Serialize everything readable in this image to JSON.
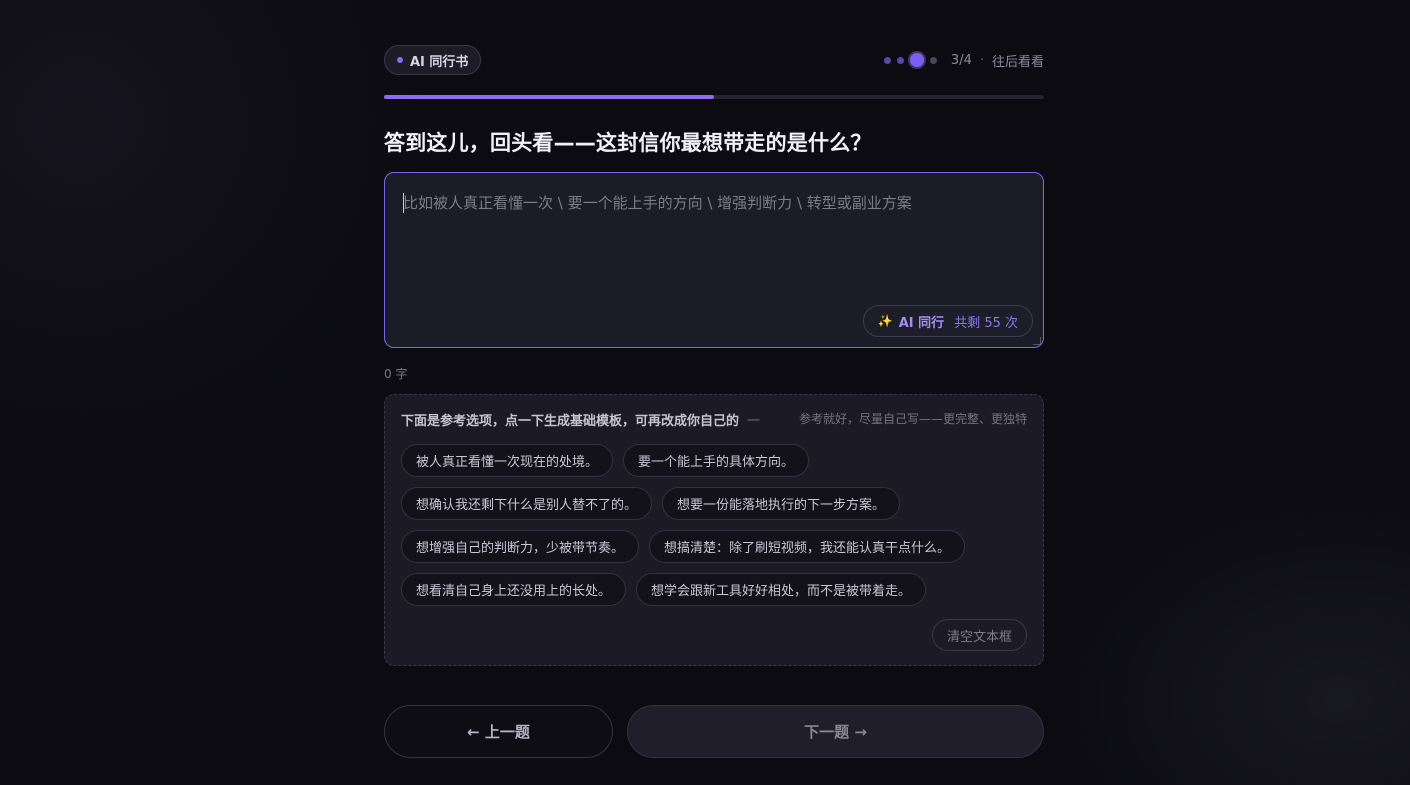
{
  "header": {
    "brand_label": "AI 同行书",
    "step_text": "3/4",
    "separator": "·",
    "skip_label": "往后看看",
    "steps_total": 4,
    "current_step": 3
  },
  "progress": {
    "fraction": 0.5
  },
  "question": {
    "title": "答到这儿，回头看——这封信你最想带走的是什么？"
  },
  "editor": {
    "value": "",
    "placeholder": "比如被人真正看懂一次 \\ 要一个能上手的方向 \\ 增强判断力 \\ 转型或副业方案",
    "ai_button": {
      "icon": "sparkles-icon",
      "label": "AI 同行",
      "remaining": "共剩 55 次"
    },
    "char_count": "0 字"
  },
  "options": {
    "heading": "下面是参考选项，点一下生成基础模板，可再改成你自己的",
    "heading_dash": "一",
    "tip": "参考就好，尽量自己写——更完整、更独特",
    "chips": [
      [
        "被人真正看懂一次现在的处境。",
        "要一个能上手的具体方向。"
      ],
      [
        "想确认我还剩下什么是别人替不了的。",
        "想要一份能落地执行的下一步方案。"
      ],
      [
        "想增强自己的判断力，少被带节奏。",
        "想搞清楚：除了刷短视频，我还能认真干点什么。"
      ],
      [
        "想看清自己身上还没用上的长处。",
        "想学会跟新工具好好相处，而不是被带着走。"
      ]
    ],
    "clear_label": "清空文本框"
  },
  "nav": {
    "prev_label": "← 上一题",
    "next_label": "下一题 →"
  },
  "colors": {
    "accent": "#8b6cf2",
    "background": "#0c0b12",
    "panel": "#1b1a25"
  }
}
